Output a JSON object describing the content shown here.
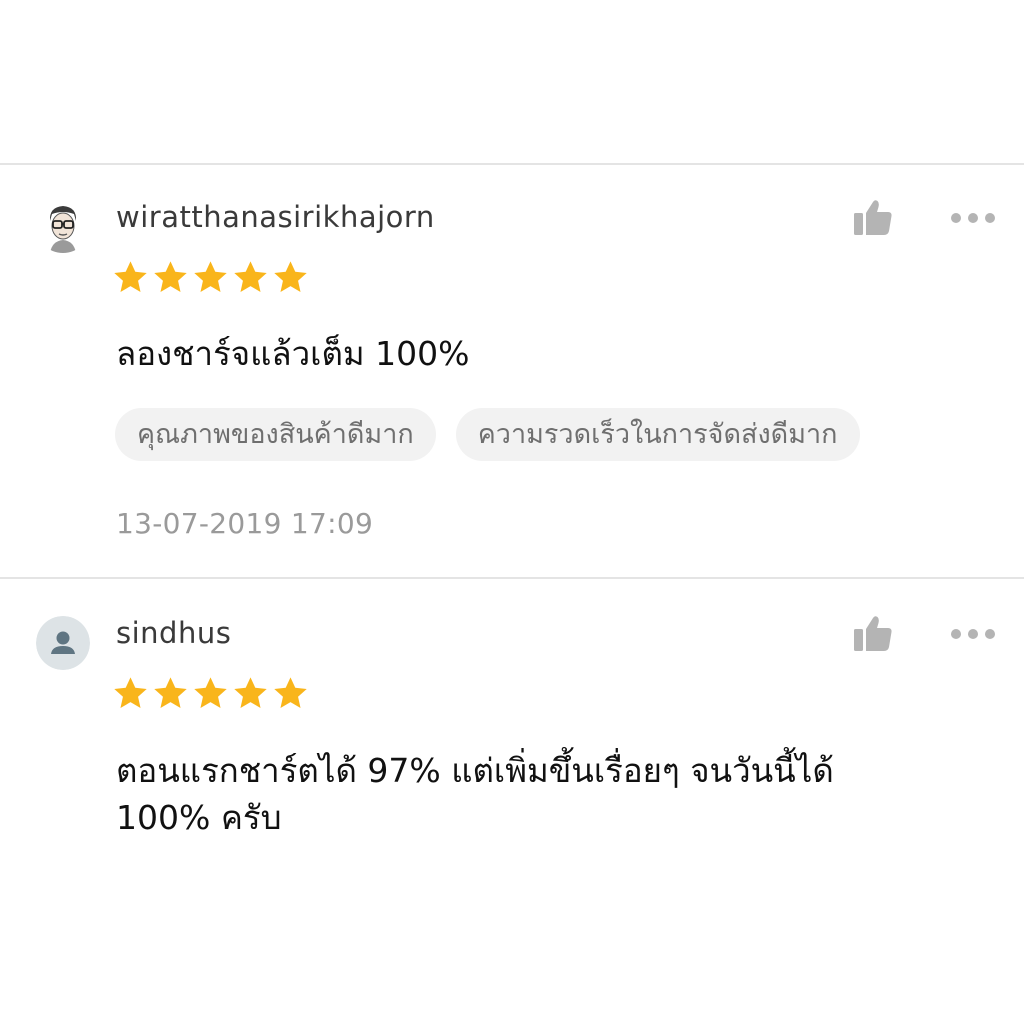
{
  "reviews": [
    {
      "username": "wiratthanasirikhajorn",
      "rating": 5,
      "avatar_icon": "cartoon-face-avatar",
      "comment": "ลองชาร์จแล้วเต็ม 100%",
      "tags": [
        "คุณภาพของสินค้าดีมาก",
        "ความรวดเร็วในการจัดส่งดีมาก"
      ],
      "timestamp": "13-07-2019 17:09"
    },
    {
      "username": "sindhus",
      "rating": 5,
      "avatar_icon": "default-user-avatar",
      "comment_line1": "ตอนแรกชาร์ตได้ 97% แต่เพิ่มขึ้นเรื่อยๆ จนวันนี้ได้",
      "comment_line2": "100% ครับ"
    }
  ],
  "icons": {
    "like": "thumbs-up-icon",
    "more": "more-options-icon",
    "star": "star-icon"
  },
  "colors": {
    "star": "#f9b51b",
    "icon_gray": "#b4b4b4",
    "tag_bg": "#f2f2f2",
    "divider": "#e4e4e4",
    "timestamp": "#9a9a9a"
  }
}
